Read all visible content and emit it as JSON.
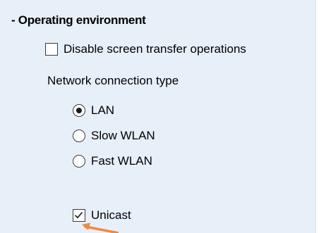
{
  "section": {
    "heading": "- Operating environment"
  },
  "options": {
    "disable_screen_transfer": {
      "label": "Disable screen transfer operations",
      "checked": false
    }
  },
  "network": {
    "label": "Network connection type",
    "selected": "LAN",
    "choices": [
      {
        "label": "LAN",
        "selected": true
      },
      {
        "label": "Slow WLAN",
        "selected": false
      },
      {
        "label": "Fast WLAN",
        "selected": false
      }
    ]
  },
  "unicast": {
    "label": "Unicast",
    "checked": true
  },
  "colors": {
    "panel_background": "#e7eff9",
    "annotation_arrow": "#f08a3c"
  },
  "icons": {
    "annotation": "arrow-icon"
  }
}
